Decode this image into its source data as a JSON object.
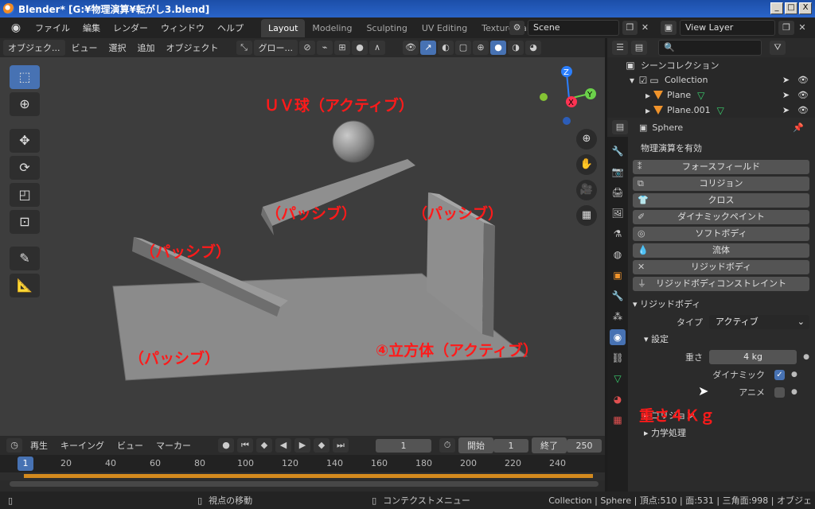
{
  "window": {
    "title": "Blender* [G:¥物理演算¥転がし3.blend]",
    "btn_min": "_",
    "btn_max": "□",
    "btn_close": "X"
  },
  "topbar": {
    "menus": [
      "ファイル",
      "編集",
      "レンダー",
      "ウィンドウ",
      "ヘルプ"
    ],
    "workspaces": [
      "Layout",
      "Modeling",
      "Sculpting",
      "UV Editing",
      "Texture Paint"
    ],
    "scene": "Scene",
    "view_layer": "View Layer"
  },
  "viewport": {
    "mode": "オブジェク...",
    "menus": [
      "ビュー",
      "選択",
      "追加",
      "オブジェクト"
    ],
    "orientation": "グロー...",
    "axes": {
      "z": "Z",
      "x": "X",
      "y": "Y"
    }
  },
  "annotations": {
    "sphere": "ＵＶ球（アクティブ）",
    "passive_ramp": "（パッシブ）",
    "passive_wall": "（パッシブ）",
    "passive_slope": "（パッシブ）",
    "passive_floor": "（パッシブ）",
    "cube": "④立方体（アクティブ）",
    "mass_note": "重さ４Ｋｇ"
  },
  "timeline": {
    "menus": [
      "再生",
      "キーイング",
      "ビュー",
      "マーカー"
    ],
    "current_frame": "1",
    "start_label": "開始",
    "start": "1",
    "end_label": "終了",
    "end": "250",
    "ruler_current": "1",
    "ticks": [
      "20",
      "40",
      "60",
      "80",
      "100",
      "120",
      "140",
      "160",
      "180",
      "200",
      "220",
      "240"
    ]
  },
  "outliner": {
    "scene_collection": "シーンコレクション",
    "collection": "Collection",
    "items": [
      "Plane",
      "Plane.001"
    ]
  },
  "properties": {
    "object": "Sphere",
    "physics_title": "物理演算を有効",
    "buttons": [
      "フォースフィールド",
      "コリジョン",
      "クロス",
      "ダイナミックペイント",
      "ソフトボディ",
      "流体",
      "リジッドボディ",
      "リジッドボディコンストレイント"
    ],
    "rigidbody_panel": "リジッドボディ",
    "type_label": "タイプ",
    "type_value": "アクティブ",
    "settings_panel": "設定",
    "mass_label": "重さ",
    "mass_value": "4 kg",
    "dynamic_label": "ダイナミック",
    "animated_label": "アニメ",
    "collision_panel": "コリジョン",
    "dynamics_panel": "力学処理"
  },
  "statusbar": {
    "hint_move": "視点の移動",
    "hint_context": "コンテクストメニュー",
    "stats": "Collection | Sphere | 頂点:510 | 面:531 | 三角面:998 | オブジェ"
  }
}
